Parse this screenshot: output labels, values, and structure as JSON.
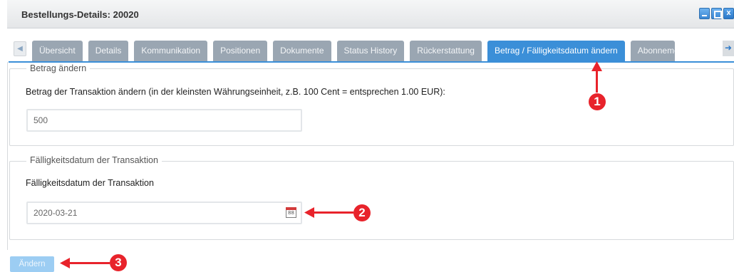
{
  "window": {
    "title": "Bestellungs-Details: 20020",
    "close_glyph": "x"
  },
  "tabs": [
    {
      "label": "Übersicht"
    },
    {
      "label": "Details"
    },
    {
      "label": "Kommunikation"
    },
    {
      "label": "Positionen"
    },
    {
      "label": "Dokumente"
    },
    {
      "label": "Status History"
    },
    {
      "label": "Rückerstattung"
    },
    {
      "label": "Betrag / Fälligkeitsdatum ändern",
      "active": true
    },
    {
      "label": "Abonnement"
    }
  ],
  "amount_section": {
    "legend": "Betrag ändern",
    "label": "Betrag der Transaktion ändern (in der kleinsten Währungseinheit, z.B. 100 Cent = entsprechen 1.00 EUR):",
    "value": "500"
  },
  "due_section": {
    "legend": "Fälligkeitsdatum der Transaktion",
    "label": "Fälligkeitsdatum der Transaktion",
    "value": "2020-03-21"
  },
  "submit_label": "Ändern",
  "annotations": [
    "1",
    "2",
    "3"
  ],
  "colors": {
    "accent": "#3b8fd8",
    "tab_inactive": "#9aa6b2",
    "annotation": "#e8232b",
    "button_disabled": "#9ccdf3"
  }
}
